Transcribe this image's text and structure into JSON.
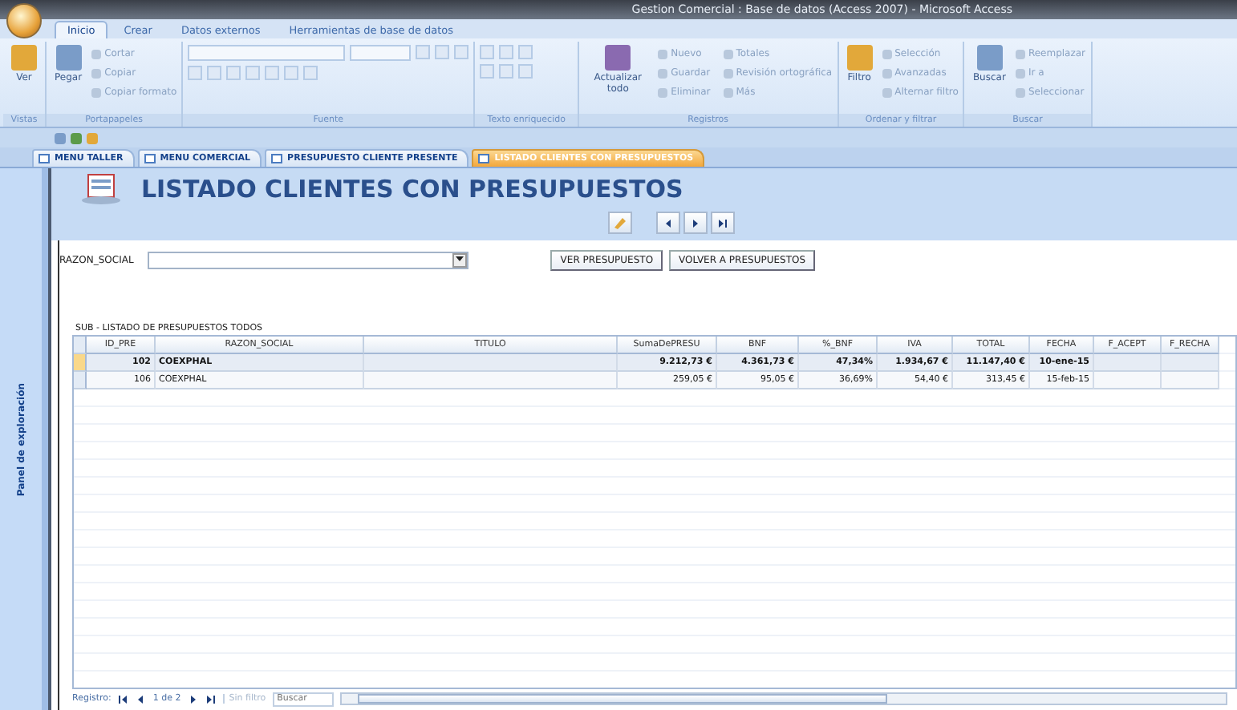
{
  "window": {
    "title": "Gestion Comercial : Base de datos (Access 2007) - Microsoft Access"
  },
  "ribbon_tabs": [
    {
      "label": "Inicio",
      "selected": true
    },
    {
      "label": "Crear",
      "selected": false
    },
    {
      "label": "Datos externos",
      "selected": false
    },
    {
      "label": "Herramientas de base de datos",
      "selected": false
    }
  ],
  "ribbon_groups": [
    {
      "title": "Vistas",
      "large": [
        "Ver"
      ]
    },
    {
      "title": "Portapapeles",
      "large": [
        "Pegar"
      ],
      "small": [
        "Cortar",
        "Copiar",
        "Copiar formato"
      ]
    },
    {
      "title": "Fuente",
      "kind": "font"
    },
    {
      "title": "Texto enriquecido",
      "kind": "rich"
    },
    {
      "title": "Registros",
      "large": [
        "Actualizar todo"
      ],
      "small": [
        "Nuevo",
        "Guardar",
        "Eliminar",
        "Totales",
        "Revisión ortográfica",
        "Más"
      ]
    },
    {
      "title": "Ordenar y filtrar",
      "large": [
        "Filtro"
      ],
      "small": [
        "Selección",
        "Avanzadas",
        "Alternar filtro"
      ]
    },
    {
      "title": "Buscar",
      "large": [
        "Buscar"
      ],
      "small": [
        "Reemplazar",
        "Ir a",
        "Seleccionar"
      ]
    }
  ],
  "doc_tabs": [
    {
      "label": "MENU TALLER",
      "selected": false
    },
    {
      "label": "MENU COMERCIAL",
      "selected": false
    },
    {
      "label": "PRESUPUESTO CLIENTE PRESENTE",
      "selected": false
    },
    {
      "label": "LISTADO CLIENTES CON PRESUPUESTOS",
      "selected": true
    }
  ],
  "nav_pane": {
    "label": "Panel de exploración"
  },
  "form": {
    "title": "LISTADO CLIENTES CON PRESUPUESTOS",
    "combo_label": "RAZON_SOCIAL",
    "buttons": [
      "VER PRESUPUESTO",
      "VOLVER A  PRESUPUESTOS"
    ],
    "subform_label": "SUB - LISTADO DE PRESUPUESTOS TODOS"
  },
  "table": {
    "columns": [
      "ID_PRE",
      "RAZON_SOCIAL",
      "TITULO",
      "SumaDePRESU",
      "BNF",
      "%_BNF",
      "IVA",
      "TOTAL",
      "FECHA",
      "F_ACEPT",
      "F_RECHA"
    ],
    "rows": [
      {
        "selected": true,
        "cells": [
          "102",
          "COEXPHAL",
          "",
          "9.212,73 €",
          "4.361,73 €",
          "47,34%",
          "1.934,67 €",
          "11.147,40 €",
          "10-ene-15",
          "",
          ""
        ]
      },
      {
        "selected": false,
        "cells": [
          "106",
          "COEXPHAL",
          "",
          "259,05 €",
          "95,05 €",
          "36,69%",
          "54,40 €",
          "313,45 €",
          "15-feb-15",
          "",
          ""
        ]
      }
    ]
  },
  "record_nav": {
    "label": "Registro:",
    "position": "1 de 2",
    "filter": "Sin filtro",
    "placeholder": "Buscar"
  }
}
